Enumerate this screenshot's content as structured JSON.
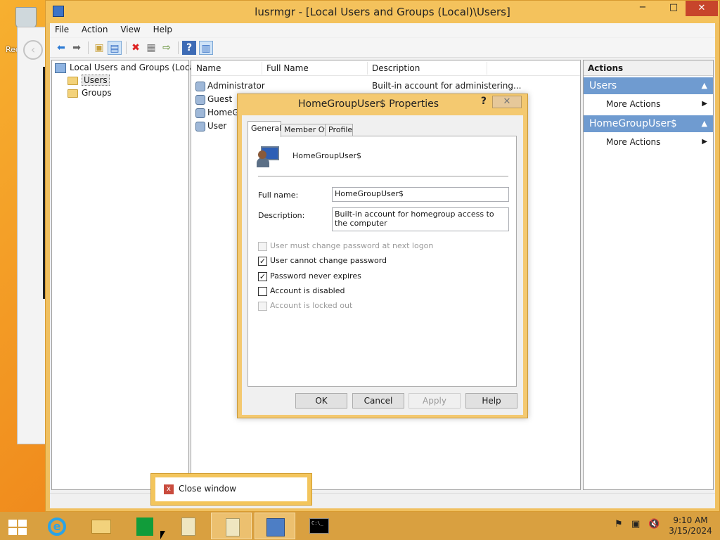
{
  "desktop": {
    "recycle_label": "Rec"
  },
  "window": {
    "title": "lusrmgr - [Local Users and Groups (Local)\\Users]",
    "minimize": "−",
    "maximize": "□",
    "close": "✕"
  },
  "menu": [
    "File",
    "Action",
    "View",
    "Help"
  ],
  "tree": {
    "root": "Local Users and Groups (Local)",
    "items": [
      "Users",
      "Groups"
    ]
  },
  "list": {
    "columns": [
      "Name",
      "Full Name",
      "Description"
    ],
    "rows": [
      {
        "name": "Administrator",
        "full_name": "",
        "description": "Built-in account for administering..."
      },
      {
        "name": "Guest",
        "full_name": "",
        "description": ""
      },
      {
        "name": "HomeG",
        "full_name": "",
        "description": ""
      },
      {
        "name": "User",
        "full_name": "",
        "description": ""
      }
    ]
  },
  "actions": {
    "header": "Actions",
    "groups": [
      {
        "title": "Users",
        "item": "More Actions"
      },
      {
        "title": "HomeGroupUser$",
        "item": "More Actions"
      }
    ]
  },
  "dialog": {
    "title": "HomeGroupUser$ Properties",
    "help_glyph": "?",
    "close_glyph": "✕",
    "tabs": [
      "General",
      "Member Of",
      "Profile"
    ],
    "active_tab": "General",
    "username": "HomeGroupUser$",
    "full_name_label": "Full name:",
    "full_name_value": "HomeGroupUser$",
    "description_label": "Description:",
    "description_value": "Built-in account for homegroup access to the computer",
    "checkboxes": [
      {
        "label": "User must change password at next logon",
        "checked": false,
        "disabled": true
      },
      {
        "label": "User cannot change password",
        "checked": true,
        "disabled": false
      },
      {
        "label": "Password never expires",
        "checked": true,
        "disabled": false
      },
      {
        "label": "Account is disabled",
        "checked": false,
        "disabled": false
      },
      {
        "label": "Account is locked out",
        "checked": false,
        "disabled": true
      }
    ],
    "buttons": {
      "ok": "OK",
      "cancel": "Cancel",
      "apply": "Apply",
      "help": "Help"
    }
  },
  "tooltip": {
    "text": "Close window",
    "icon": "x"
  },
  "taskbar": {
    "cmd_text": "C:\\_",
    "time": "9:10 AM",
    "date": "3/15/2024"
  }
}
